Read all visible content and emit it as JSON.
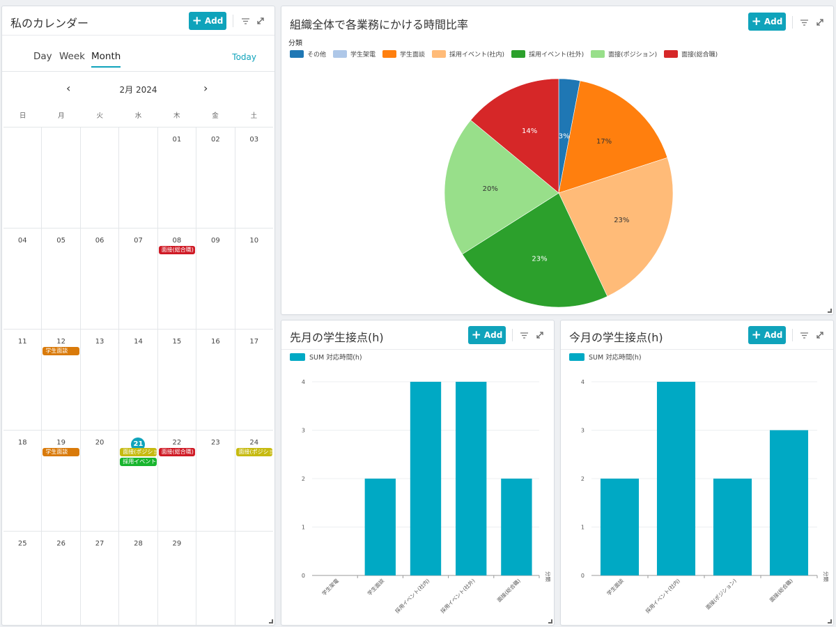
{
  "calendar": {
    "title": "私のカレンダー",
    "add_label": "Add",
    "tabs": [
      "Day",
      "Week",
      "Month"
    ],
    "active_tab": "Month",
    "today_label": "Today",
    "month_label": "2月 2024",
    "weekdays": [
      "日",
      "月",
      "火",
      "水",
      "木",
      "金",
      "土"
    ],
    "weeks": [
      [
        "",
        "",
        "",
        "",
        "01",
        "02",
        "03"
      ],
      [
        "04",
        "05",
        "06",
        "07",
        "08",
        "09",
        "10"
      ],
      [
        "11",
        "12",
        "13",
        "14",
        "15",
        "16",
        "17"
      ],
      [
        "18",
        "19",
        "20",
        "21",
        "22",
        "23",
        "24"
      ],
      [
        "25",
        "26",
        "27",
        "28",
        "29",
        "",
        ""
      ]
    ],
    "today": "21",
    "events": [
      {
        "day": "08",
        "label": "面接(総合職)",
        "color": "#cf1a25"
      },
      {
        "day": "12",
        "label": "学生面談",
        "color": "#d97a0a"
      },
      {
        "day": "19",
        "label": "学生面談",
        "color": "#d97a0a"
      },
      {
        "day": "21",
        "label": "面接(ポジション)",
        "color": "#c6ba10"
      },
      {
        "day": "21",
        "label": "採用イベント(社外)",
        "color": "#18b52e"
      },
      {
        "day": "22",
        "label": "面接(総合職)",
        "color": "#cf1a25"
      },
      {
        "day": "24",
        "label": "面接(ポジション)",
        "color": "#c6ba10"
      }
    ]
  },
  "pie_widget": {
    "title": "組織全体で各業務にかける時間比率",
    "add_label": "Add",
    "legend_title": "分類"
  },
  "last_month_widget": {
    "title": "先月の学生接点(h)",
    "add_label": "Add"
  },
  "this_month_widget": {
    "title": "今月の学生接点(h)",
    "add_label": "Add"
  },
  "chart_data": [
    {
      "type": "pie",
      "legend_title": "分類",
      "legend": [
        {
          "name": "その他",
          "color": "#1f77b4"
        },
        {
          "name": "学生架電",
          "color": "#aec7e8"
        },
        {
          "name": "学生面談",
          "color": "#ff7f0e"
        },
        {
          "name": "採用イベント(社内)",
          "color": "#ffbb78"
        },
        {
          "name": "採用イベント(社外)",
          "color": "#2ca02c"
        },
        {
          "name": "面接(ポジション)",
          "color": "#98df8a"
        },
        {
          "name": "面接(総合職)",
          "color": "#d62728"
        }
      ],
      "slices": [
        {
          "name": "その他",
          "value": 3,
          "label": "3%",
          "color": "#1f77b4"
        },
        {
          "name": "学生面談",
          "value": 17,
          "label": "17%",
          "color": "#ff7f0e"
        },
        {
          "name": "採用イベント(社内)",
          "value": 23,
          "label": "23%",
          "color": "#ffbb78"
        },
        {
          "name": "採用イベント(社外)",
          "value": 23,
          "label": "23%",
          "color": "#2ca02c"
        },
        {
          "name": "面接(ポジション)",
          "value": 20,
          "label": "20%",
          "color": "#98df8a"
        },
        {
          "name": "面接(総合職)",
          "value": 14,
          "label": "14%",
          "color": "#d62728"
        }
      ]
    },
    {
      "type": "bar",
      "series_name": "SUM 対応時間(h)",
      "xlabel": "分類",
      "categories": [
        "学生架電",
        "学生面談",
        "採用イベント(社内)",
        "採用イベント(社外)",
        "面接(総合職)"
      ],
      "values": [
        0,
        2,
        4,
        4,
        2
      ],
      "ylim": [
        0,
        4
      ],
      "yticks": [
        "0",
        "1",
        "2",
        "3",
        "4"
      ],
      "color": "#00a9c4"
    },
    {
      "type": "bar",
      "series_name": "SUM 対応時間(h)",
      "xlabel": "分類",
      "categories": [
        "学生面談",
        "採用イベント(社内)",
        "面接(ポジション)",
        "面接(総合職)"
      ],
      "values": [
        2,
        4,
        2,
        3
      ],
      "ylim": [
        0,
        4
      ],
      "yticks": [
        "0",
        "1",
        "2",
        "3",
        "4"
      ],
      "color": "#00a9c4"
    }
  ]
}
